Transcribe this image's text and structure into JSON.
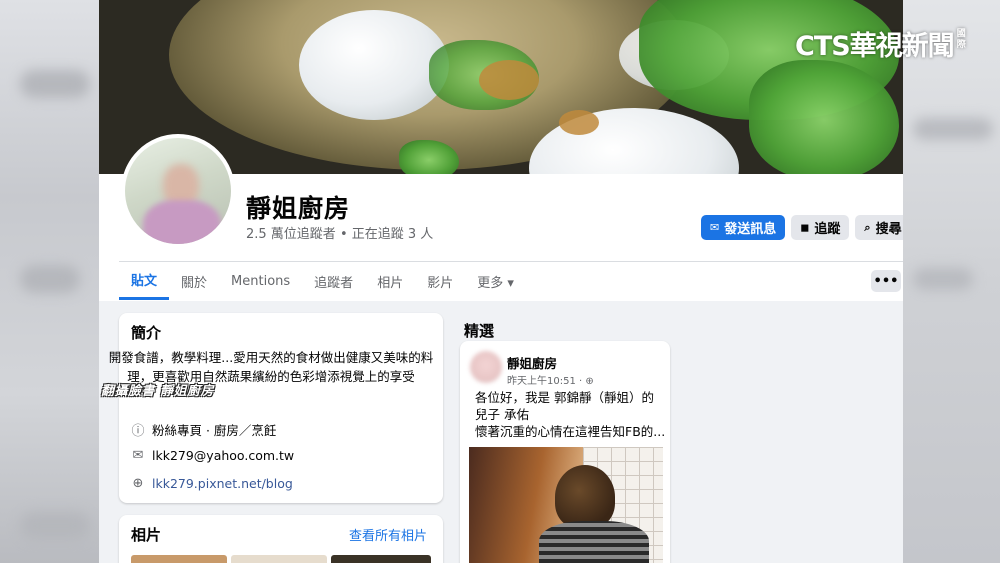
{
  "page": {
    "name": "靜姐廚房",
    "stats": "2.5 萬位追蹤者 • 正在追蹤 3 人"
  },
  "actions": {
    "message": "發送訊息",
    "follow": "追蹤",
    "search": "搜尋"
  },
  "tabs": [
    "貼文",
    "關於",
    "Mentions",
    "追蹤者",
    "相片",
    "影片",
    "更多 ▾"
  ],
  "more_menu": "•••",
  "intro": {
    "title": "簡介",
    "text": "開發食譜，教學料理...愛用天然的食材做出健康又美味的料理，更喜歡用自然蔬果繽紛的色彩增添視覺上的享受",
    "category": "粉絲專頁 · 廚房／烹飪",
    "email": "lkk279@yahoo.com.tw",
    "website": "lkk279.pixnet.net/blog"
  },
  "photos": {
    "title": "相片",
    "see_all": "查看所有相片"
  },
  "featured": {
    "title": "精選",
    "post": {
      "author": "靜姐廚房",
      "time": "昨天上午10:51 ·",
      "lines": [
        "各位好，我是 郭錦靜（靜姐）的",
        "兒子 承佑",
        "懷著沉重的心情在這裡告知FB的..."
      ]
    }
  },
  "overlay_caption": "翻攝臉書 靜姐廚房",
  "watermark": {
    "main": "CTS華視新聞",
    "side": "國際"
  },
  "colors": {
    "facebook_blue": "#1b74e4",
    "secondary_button": "#e4e6eb",
    "text_secondary": "#65676b"
  }
}
